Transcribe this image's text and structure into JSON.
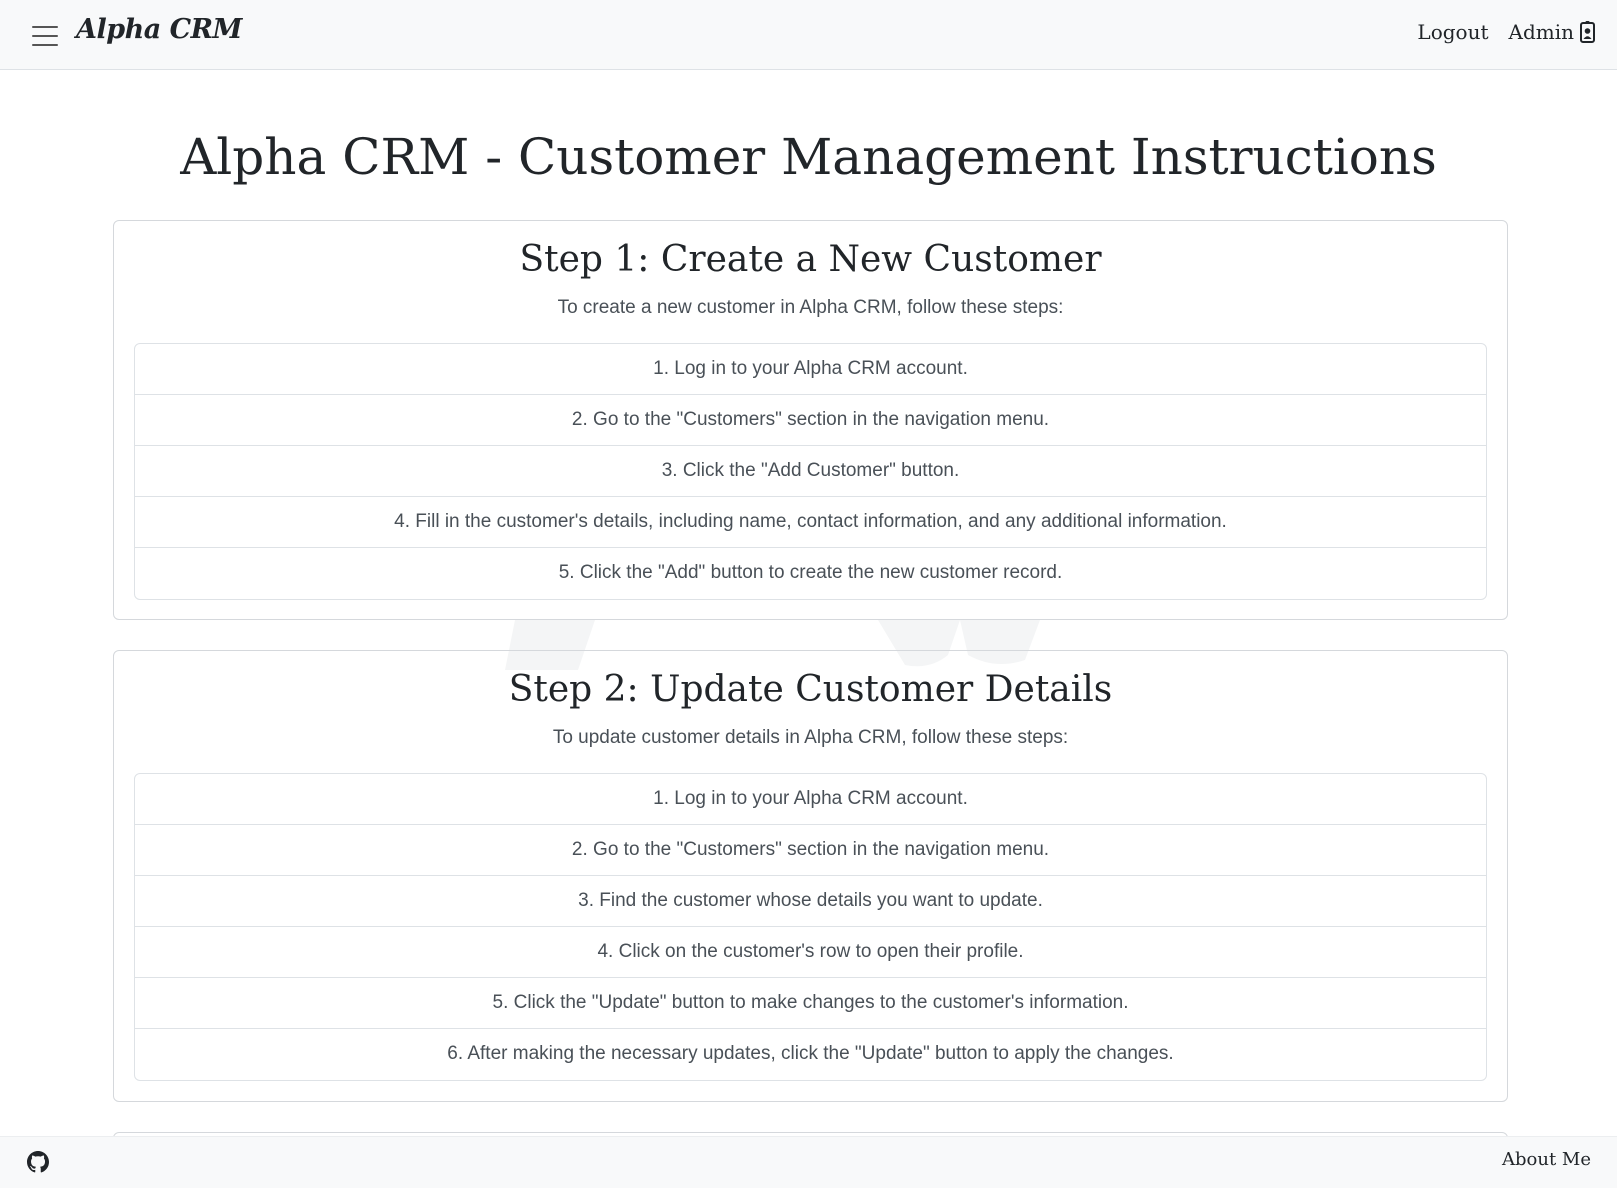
{
  "header": {
    "brand": "Alpha CRM",
    "logout_label": "Logout",
    "admin_label": "Admin",
    "menu_icon": "hamburger-icon",
    "user_icon": "user-badge-icon"
  },
  "main": {
    "title": "Alpha CRM - Customer Management Instructions",
    "cards": [
      {
        "title": "Step 1: Create a New Customer",
        "intro": "To create a new customer in Alpha CRM, follow these steps:",
        "steps": [
          "1. Log in to your Alpha CRM account.",
          "2. Go to the \"Customers\" section in the navigation menu.",
          "3. Click the \"Add Customer\" button.",
          "4. Fill in the customer's details, including name, contact information, and any additional information.",
          "5. Click the \"Add\" button to create the new customer record."
        ]
      },
      {
        "title": "Step 2: Update Customer Details",
        "intro": "To update customer details in Alpha CRM, follow these steps:",
        "steps": [
          "1. Log in to your Alpha CRM account.",
          "2. Go to the \"Customers\" section in the navigation menu.",
          "3. Find the customer whose details you want to update.",
          "4. Click on the customer's row to open their profile.",
          "5. Click the \"Update\" button to make changes to the customer's information.",
          "6. After making the necessary updates, click the \"Update\" button to apply the changes."
        ]
      }
    ]
  },
  "footer": {
    "about_label": "About Me",
    "github_icon": "github-icon"
  },
  "colors": {
    "navbar_bg": "#f8f9fa",
    "text": "#212529",
    "muted_text": "#495057",
    "border": "#dee2e6"
  }
}
